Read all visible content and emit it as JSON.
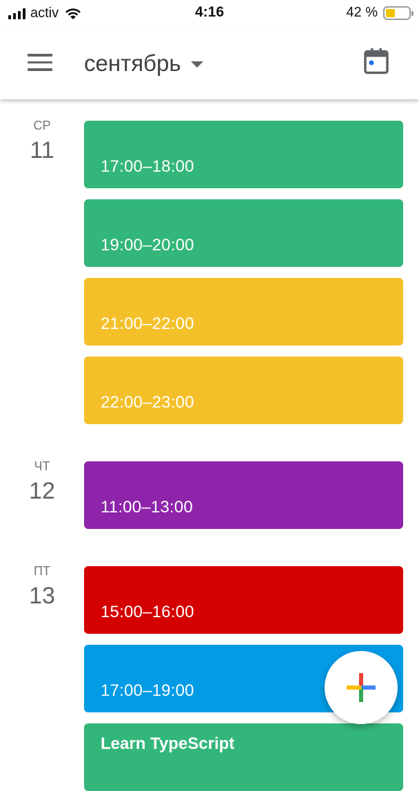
{
  "status_bar": {
    "carrier": "activ",
    "time": "4:16",
    "battery_percent": "42 %",
    "battery_level": 0.42,
    "icons": [
      "signal-icon",
      "wifi-icon",
      "battery-icon"
    ]
  },
  "header": {
    "menu_icon": "hamburger-menu-icon",
    "month": "сентябрь",
    "dropdown_icon": "caret-down-icon",
    "today_icon": "calendar-today-icon"
  },
  "colors": {
    "green": "#33b679",
    "yellow": "#f4c02a",
    "purple": "#8e24aa",
    "red": "#d50000",
    "blue": "#039be5"
  },
  "days": [
    {
      "weekday": "СР",
      "date": "11",
      "events": [
        {
          "time": "17:00–18:00",
          "color": "#33b679"
        },
        {
          "time": "19:00–20:00",
          "color": "#33b679"
        },
        {
          "time": "21:00–22:00",
          "color": "#f4c02a"
        },
        {
          "time": "22:00–23:00",
          "color": "#f4c02a"
        }
      ]
    },
    {
      "weekday": "ЧТ",
      "date": "12",
      "events": [
        {
          "time": "11:00–13:00",
          "color": "#8e24aa"
        }
      ]
    },
    {
      "weekday": "ПТ",
      "date": "13",
      "events": [
        {
          "time": "15:00–16:00",
          "color": "#d50000"
        },
        {
          "time": "17:00–19:00",
          "color": "#039be5"
        },
        {
          "title": "Learn TypeScript",
          "color": "#33b679"
        }
      ]
    }
  ],
  "fab": {
    "icon": "add-event-plus-icon"
  }
}
